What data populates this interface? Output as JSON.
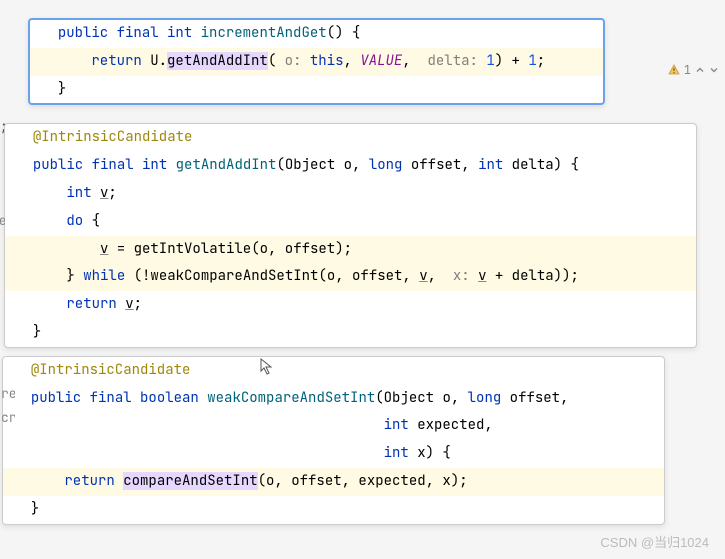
{
  "panel1": {
    "l1_kw1": "public",
    "l1_kw2": "final",
    "l1_type": "int",
    "l1_method": "incrementAndGet",
    "l1_tail": "() {",
    "l2_kw": "return",
    "l2_obj": "U",
    "l2_method": "getAndAddInt",
    "l2_p1k": "o:",
    "l2_p1v": "this",
    "l2_field": "VALUE",
    "l2_p2k": "delta:",
    "l2_p2v": "1",
    "l2_tail1": ") + ",
    "l2_num": "1",
    "l2_tail2": ";",
    "l3": "}"
  },
  "panel2": {
    "l1_ann": "@IntrinsicCandidate",
    "l2_kw1": "public",
    "l2_kw2": "final",
    "l2_type": "int",
    "l2_method": "getAndAddInt",
    "l2_sig_a": "(Object o, ",
    "l2_sig_long": "long",
    "l2_sig_b": " offset, ",
    "l2_sig_int": "int",
    "l2_sig_c": " delta) {",
    "l3_type": "int",
    "l3_var": "v",
    "l3_tail": ";",
    "l4_kw": "do",
    "l4_tail": " {",
    "l5_var": "v",
    "l5_mid": " = getIntVolatile(o, offset);",
    "l6_a": "} ",
    "l6_while": "while",
    "l6_b": " (!weakCompareAndSetInt(o, offset, ",
    "l6_v1": "v",
    "l6_c": ", ",
    "l6_xk": "x:",
    "l6_v2": "v",
    "l6_d": " + delta));",
    "l7_kw": "return",
    "l7_var": "v",
    "l7_tail": ";",
    "l8": "}"
  },
  "panel3": {
    "l1_ann": "@IntrinsicCandidate",
    "l2_kw1": "public",
    "l2_kw2": "final",
    "l2_type": "boolean",
    "l2_method": "weakCompareAndSetInt",
    "l2_sig_a": "(Object o, ",
    "l2_sig_long": "long",
    "l2_sig_b": " offset,",
    "l3_type": "int",
    "l3_rest": " expected,",
    "l4_type": "int",
    "l4_rest": " x) {",
    "l5_kw": "return",
    "l5_method": "compareAndSetInt",
    "l5_tail": "(o, offset, expected, x);",
    "l6": "}"
  },
  "gutter": {
    "g1": "ge",
    "g2": "re",
    "g3": "cr"
  },
  "badge": {
    "warn_count": "1"
  },
  "watermark": "CSDN @当归1024"
}
